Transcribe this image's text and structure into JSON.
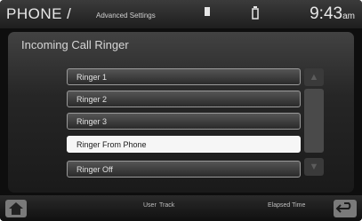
{
  "header": {
    "title": "PHONE /",
    "subtitle": "Advanced Settings",
    "signal_icon": "signal-icon",
    "phone_icon": "phone-status-icon",
    "time": "9:43",
    "time_suffix": "am"
  },
  "panel": {
    "title": "Incoming Call Ringer",
    "options": [
      {
        "label": "Ringer 1",
        "selected": false
      },
      {
        "label": "Ringer 2",
        "selected": false
      },
      {
        "label": "Ringer 3",
        "selected": false
      },
      {
        "label": "Ringer From Phone",
        "selected": true
      },
      {
        "label": "Ringer Off",
        "selected": false
      }
    ],
    "scroll_up_icon": "arrow-up-icon",
    "scroll_down_icon": "arrow-down-icon"
  },
  "footer": {
    "user_label": "User",
    "track_label": "Track",
    "elapsed_label": "Elapsed Time",
    "home_icon": "home-icon",
    "back_icon": "back-icon"
  },
  "colors": {
    "background": "#0e0e0e",
    "selected_item": "#f6f6f6",
    "item_border": "#9a9a9a"
  }
}
